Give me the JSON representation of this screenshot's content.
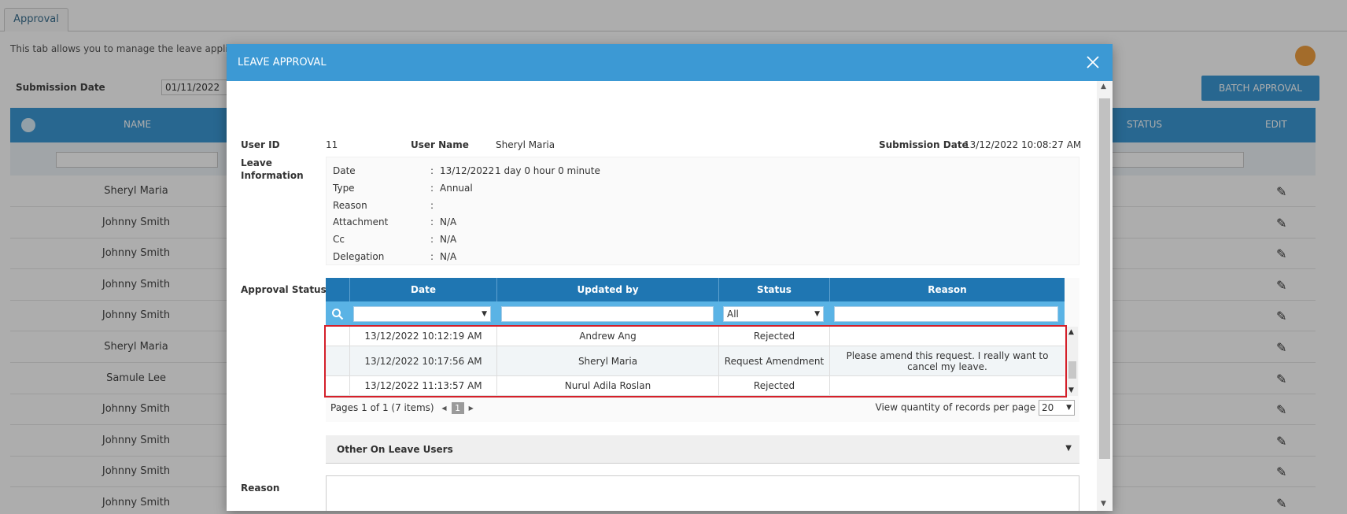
{
  "background": {
    "tab_label": "Approval",
    "description": "This tab allows you to manage the leave applica",
    "submission_date_label": "Submission Date",
    "submission_date_value": "01/11/2022",
    "batch_button": "BATCH APPROVAL",
    "columns": {
      "name": "NAME",
      "status": "STATUS",
      "edit": "EDIT"
    },
    "rows": [
      "Sheryl Maria",
      "Johnny Smith",
      "Johnny Smith",
      "Johnny Smith",
      "Johnny Smith",
      "Sheryl Maria",
      "Samule Lee",
      "Johnny Smith",
      "Johnny Smith",
      "Johnny Smith",
      "Johnny Smith"
    ],
    "accent_color": "#3c99d4"
  },
  "modal": {
    "title": "LEAVE APPROVAL",
    "user_id_label": "User ID",
    "user_id": "11",
    "user_name_label": "User Name",
    "user_name": "Sheryl Maria",
    "submission_date_label": "Submission Date",
    "submission_date": "13/12/2022 10:08:27 AM",
    "leave_info_label": "Leave Information",
    "leave_info": {
      "date_label": "Date",
      "date": "13/12/2022",
      "duration": "1 day 0 hour 0 minute",
      "type_label": "Type",
      "type": "Annual",
      "reason_label": "Reason",
      "reason": "",
      "attachment_label": "Attachment",
      "attachment": "N/A",
      "cc_label": "Cc",
      "cc": "N/A",
      "delegation_label": "Delegation",
      "delegation": "N/A"
    },
    "approval_status_label": "Approval Status",
    "approval_table": {
      "headers": {
        "date": "Date",
        "updated_by": "Updated by",
        "status": "Status",
        "reason": "Reason"
      },
      "status_filter": "All",
      "rows": [
        {
          "date": "13/12/2022 10:12:19 AM",
          "updated_by": "Andrew Ang",
          "status": "Rejected",
          "reason": ""
        },
        {
          "date": "13/12/2022 10:17:56 AM",
          "updated_by": "Sheryl Maria",
          "status": "Request Amendment",
          "reason": "Please amend this request. I really want to cancel my leave."
        },
        {
          "date": "13/12/2022 11:13:57 AM",
          "updated_by": "Nurul Adila Roslan",
          "status": "Rejected",
          "reason": ""
        }
      ],
      "pager_text": "Pages 1 of 1 (7 items)",
      "current_page": "1",
      "per_page_label": "View quantity of records per page",
      "per_page": "20"
    },
    "other_users_label": "Other On Leave Users",
    "reason_label": "Reason"
  }
}
